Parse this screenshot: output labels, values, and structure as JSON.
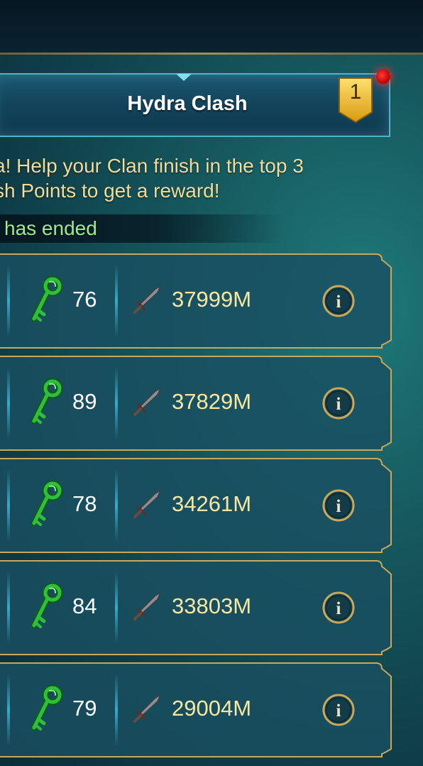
{
  "tab": {
    "title": "Hydra Clash",
    "badge_count": "1"
  },
  "description": {
    "line1": "a! Help your Clan finish in the top 3",
    "line2": "sh Points to get a reward!"
  },
  "status": "has ended",
  "rows": [
    {
      "keys": "76",
      "damage": "37999M"
    },
    {
      "keys": "89",
      "damage": "37829M"
    },
    {
      "keys": "78",
      "damage": "34261M"
    },
    {
      "keys": "84",
      "damage": "33803M"
    },
    {
      "keys": "79",
      "damage": "29004M"
    }
  ],
  "colors": {
    "accent_gold": "#c9a75b",
    "damage_text": "#f6e8a0",
    "status_green": "#9bec8a",
    "key_green": "#2fbf3a"
  },
  "icons": {
    "key": "key-icon",
    "damage": "sword-icon",
    "info": "info-icon"
  }
}
